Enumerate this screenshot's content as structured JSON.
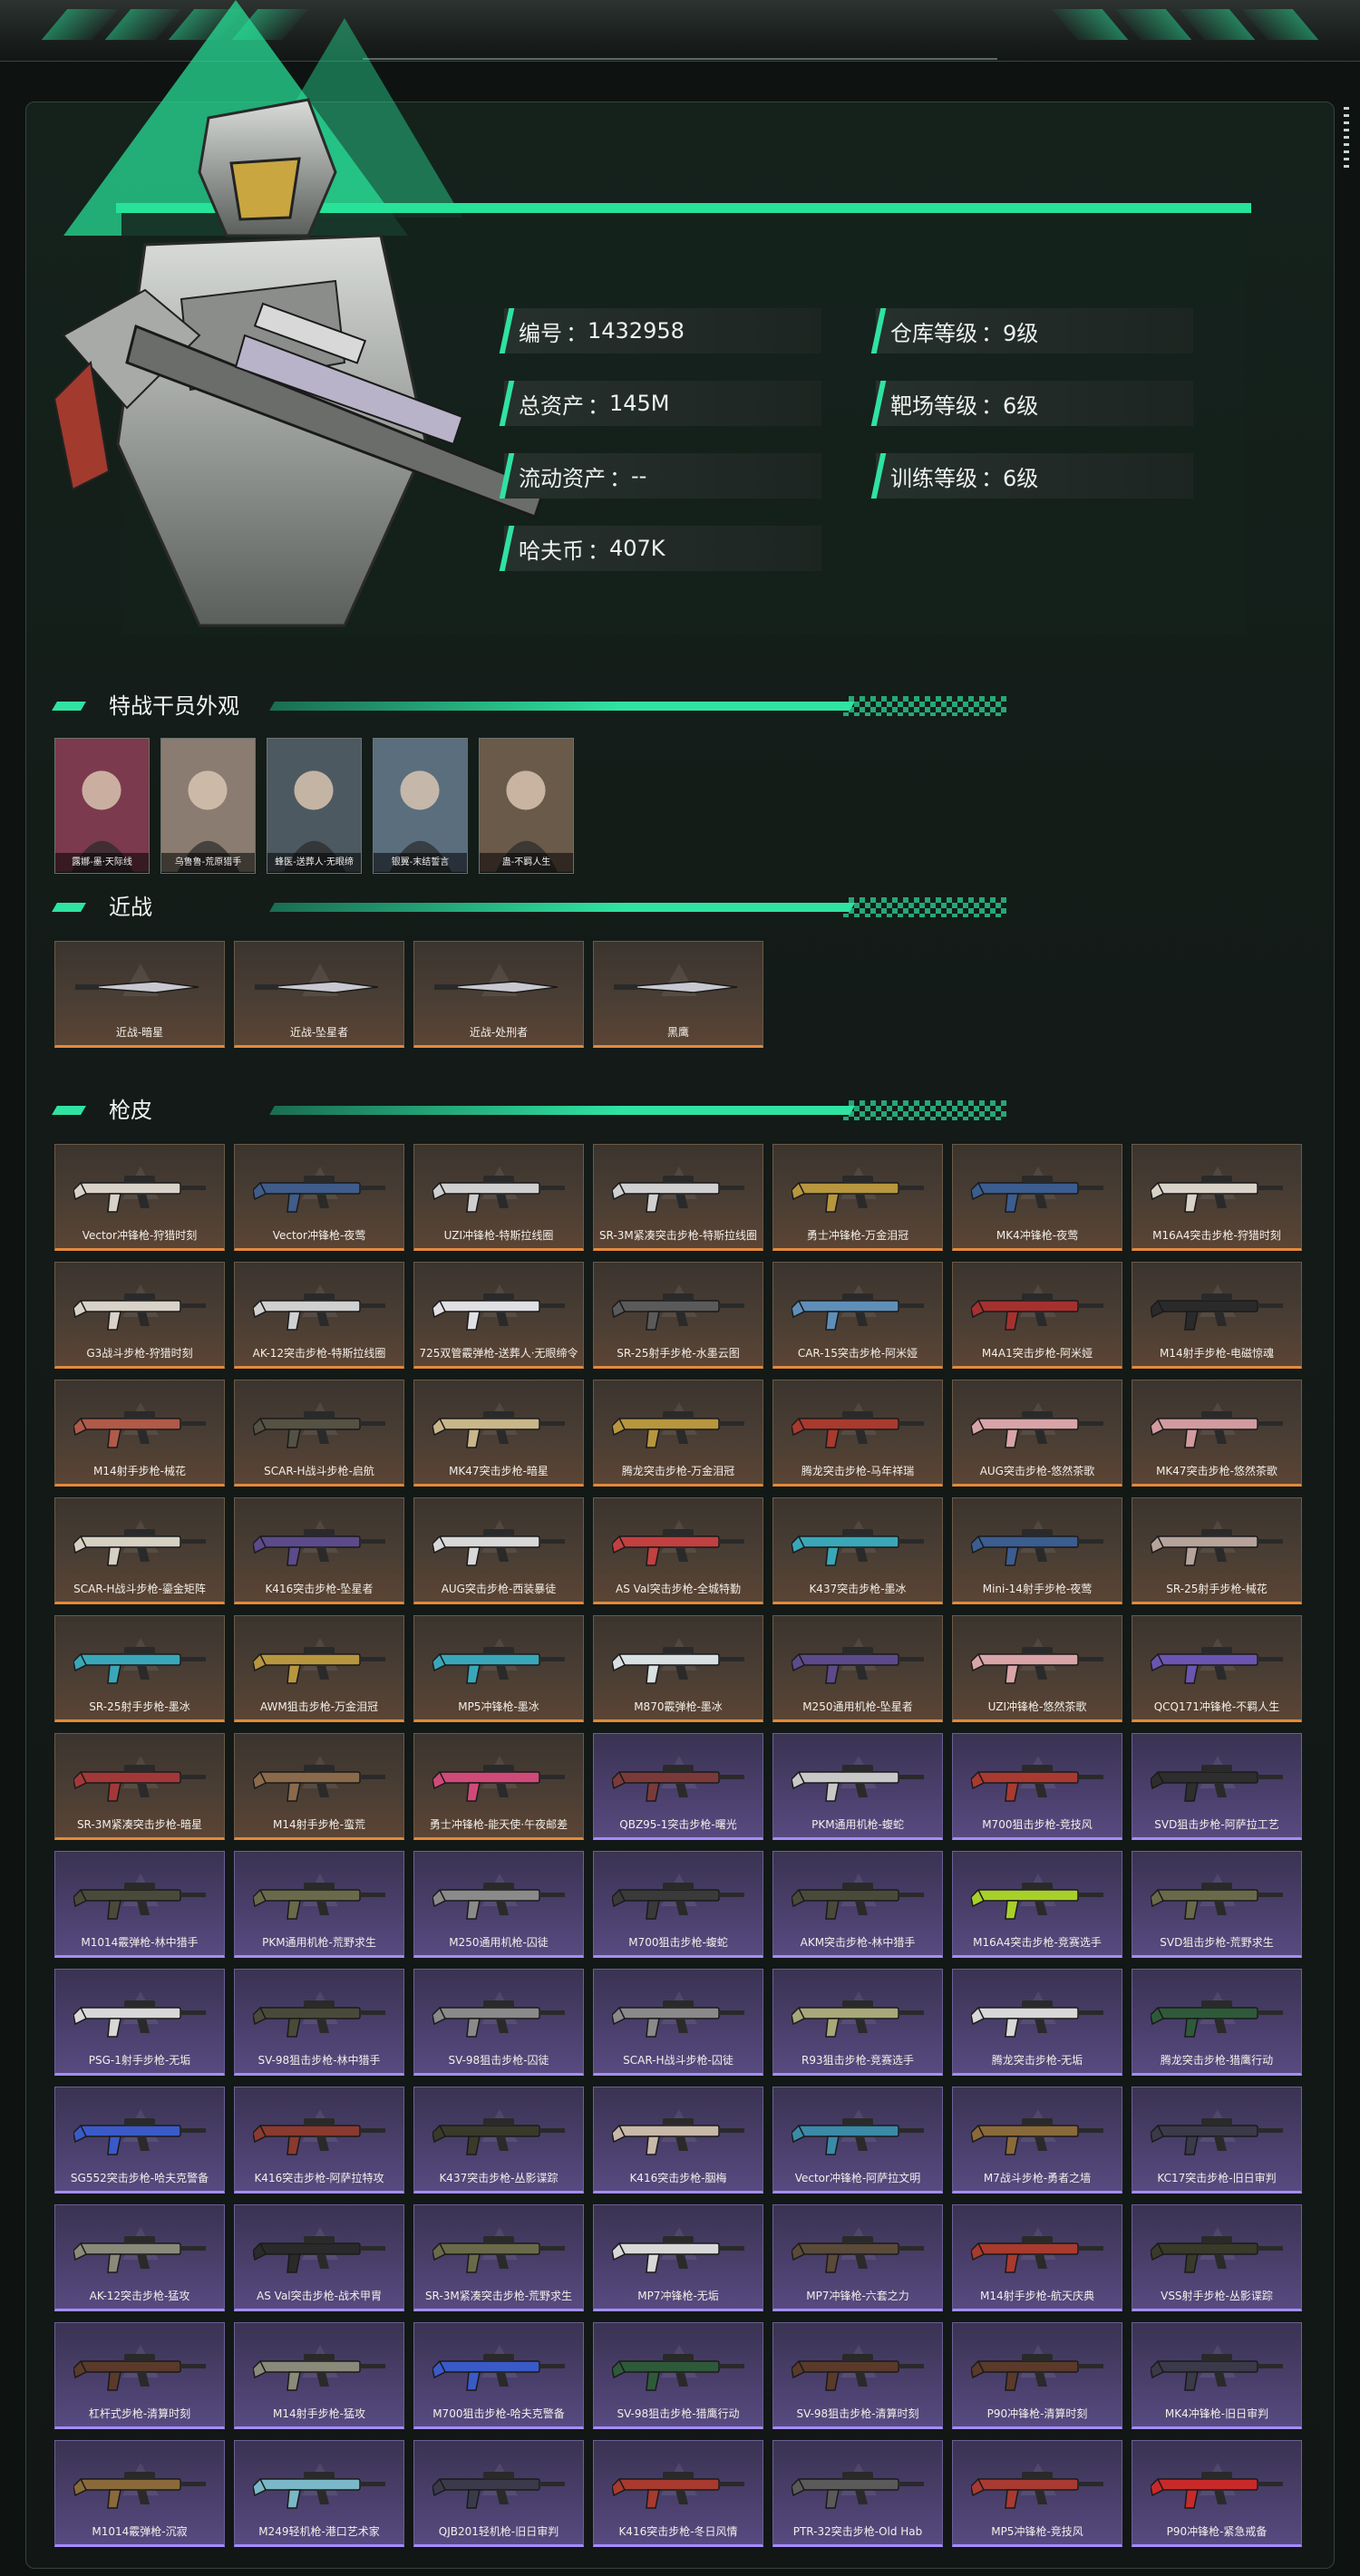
{
  "profile": {
    "stats": [
      {
        "key": "编号",
        "value": "1432958"
      },
      {
        "key": "仓库等级",
        "value": "9级"
      },
      {
        "key": "总资产",
        "value": "145M"
      },
      {
        "key": "靶场等级",
        "value": "6级"
      },
      {
        "key": "流动资产",
        "value": "--"
      },
      {
        "key": "训练等级",
        "value": "6级"
      },
      {
        "key": "哈夫币",
        "value": "407K"
      }
    ]
  },
  "sections": {
    "operators": "特战干员外观",
    "melee": "近战",
    "guns": "枪皮"
  },
  "operators": [
    {
      "name": "露娜-墨·天际线",
      "color": "#7b3a4d"
    },
    {
      "name": "乌鲁鲁-荒原猎手",
      "color": "#8a7c70"
    },
    {
      "name": "蜂医-送葬人·无眼缔",
      "color": "#4c5961"
    },
    {
      "name": "银翼-末结誓言",
      "color": "#5a6e7e"
    },
    {
      "name": "蛊-不羁人生",
      "color": "#6a5a4a"
    }
  ],
  "melee": [
    {
      "name": "近战-暗星"
    },
    {
      "name": "近战-坠星者"
    },
    {
      "name": "近战-处刑者"
    },
    {
      "name": "黑鹰"
    }
  ],
  "guns": [
    {
      "name": "Vector冲锋枪-狩猎时刻",
      "rarity": "orange",
      "color": "#d8d2c8"
    },
    {
      "name": "Vector冲锋枪-夜莺",
      "rarity": "orange",
      "color": "#3f5c8a"
    },
    {
      "name": "UZI冲锋枪-特斯拉线圈",
      "rarity": "orange",
      "color": "#cfcfcf"
    },
    {
      "name": "SR-3M紧凑突击步枪-特斯拉线圈",
      "rarity": "orange",
      "color": "#d0d0d0"
    },
    {
      "name": "勇士冲锋枪-万金泪冠",
      "rarity": "orange",
      "color": "#b7963e"
    },
    {
      "name": "MK4冲锋枪-夜莺",
      "rarity": "orange",
      "color": "#3b5d8f"
    },
    {
      "name": "M16A4突击步枪-狩猎时刻",
      "rarity": "orange",
      "color": "#d8d2c8"
    },
    {
      "name": "G3战斗步枪-狩猎时刻",
      "rarity": "orange",
      "color": "#d8d2c8"
    },
    {
      "name": "AK-12突击步枪-特斯拉线圈",
      "rarity": "orange",
      "color": "#d0d0d0"
    },
    {
      "name": "725双管霰弹枪-送葬人·无眼缔令",
      "rarity": "orange",
      "color": "#e0e0e4"
    },
    {
      "name": "SR-25射手步枪-水墨云图",
      "rarity": "orange",
      "color": "#5a5a5a"
    },
    {
      "name": "CAR-15突击步枪-阿米娅",
      "rarity": "orange",
      "color": "#5f8fb8"
    },
    {
      "name": "M4A1突击步枪-阿米娅",
      "rarity": "orange",
      "color": "#a5312f"
    },
    {
      "name": "M14射手步枪-电磁惊魂",
      "rarity": "orange",
      "color": "#2a2a2a"
    },
    {
      "name": "M14射手步枪-械花",
      "rarity": "orange",
      "color": "#b05a48"
    },
    {
      "name": "SCAR-H战斗步枪-启航",
      "rarity": "orange",
      "color": "#555244"
    },
    {
      "name": "MK47突击步枪-暗星",
      "rarity": "orange",
      "color": "#c9b78a"
    },
    {
      "name": "腾龙突击步枪-万金泪冠",
      "rarity": "orange",
      "color": "#b7963e"
    },
    {
      "name": "腾龙突击步枪-马年祥瑞",
      "rarity": "orange",
      "color": "#a83a2e"
    },
    {
      "name": "AUG突击步枪-悠然茶歌",
      "rarity": "orange",
      "color": "#d9a4a8"
    },
    {
      "name": "MK47突击步枪-悠然茶歌",
      "rarity": "orange",
      "color": "#d29ba0"
    },
    {
      "name": "SCAR-H战斗步枪-鎏金矩阵",
      "rarity": "orange",
      "color": "#d6d0c2"
    },
    {
      "name": "K416突击步枪-坠星者",
      "rarity": "orange",
      "color": "#5c4a8a"
    },
    {
      "name": "AUG突击步枪-西装暴徒",
      "rarity": "orange",
      "color": "#d8d8d8"
    },
    {
      "name": "AS Val突击步枪-全城特勤",
      "rarity": "orange",
      "color": "#c24040"
    },
    {
      "name": "K437突击步枪-墨冰",
      "rarity": "orange",
      "color": "#3aa7b8"
    },
    {
      "name": "Mini-14射手步枪-夜莺",
      "rarity": "orange",
      "color": "#3b5d8f"
    },
    {
      "name": "SR-25射手步枪-械花",
      "rarity": "orange",
      "color": "#b6a39a"
    },
    {
      "name": "SR-25射手步枪-墨冰",
      "rarity": "orange",
      "color": "#3aa7b8"
    },
    {
      "name": "AWM狙击步枪-万金泪冠",
      "rarity": "orange",
      "color": "#b7963e"
    },
    {
      "name": "MP5冲锋枪-墨冰",
      "rarity": "orange",
      "color": "#3aa7b8"
    },
    {
      "name": "M870霰弹枪-墨冰",
      "rarity": "orange",
      "color": "#d8e0e2"
    },
    {
      "name": "M250通用机枪-坠星者",
      "rarity": "orange",
      "color": "#5c4a8a"
    },
    {
      "name": "UZI冲锋枪-悠然茶歌",
      "rarity": "orange",
      "color": "#d9a4a8"
    },
    {
      "name": "QCQ171冲锋枪-不羁人生",
      "rarity": "orange",
      "color": "#6a55b0"
    },
    {
      "name": "SR-3M紧凑突击步枪-暗星",
      "rarity": "orange",
      "color": "#a33838"
    },
    {
      "name": "M14射手步枪-蛮荒",
      "rarity": "orange",
      "color": "#8a6a4a"
    },
    {
      "name": "勇士冲锋枪-能天使·午夜邮差",
      "rarity": "orange",
      "color": "#d04a78"
    },
    {
      "name": "QBZ95-1突击步枪-曙光",
      "rarity": "purple",
      "color": "#7a3a3a"
    },
    {
      "name": "PKM通用机枪-蝮蛇",
      "rarity": "purple",
      "color": "#c8c8c8"
    },
    {
      "name": "M700狙击步枪-竞技风",
      "rarity": "purple",
      "color": "#a83a32"
    },
    {
      "name": "SVD狙击步枪-阿萨拉工艺",
      "rarity": "purple",
      "color": "#2e2e2e"
    },
    {
      "name": "M1014霰弹枪-林中猎手",
      "rarity": "purple",
      "color": "#4a4a3a"
    },
    {
      "name": "PKM通用机枪-荒野求生",
      "rarity": "purple",
      "color": "#6a6a4a"
    },
    {
      "name": "M250通用机枪-囚徒",
      "rarity": "purple",
      "color": "#8a8a8a"
    },
    {
      "name": "M700狙击步枪-蝮蛇",
      "rarity": "purple",
      "color": "#3a3a3a"
    },
    {
      "name": "AKM突击步枪-林中猎手",
      "rarity": "purple",
      "color": "#4a4a3a"
    },
    {
      "name": "M16A4突击步枪-竞赛选手",
      "rarity": "purple",
      "color": "#a8d02a"
    },
    {
      "name": "SVD狙击步枪-荒野求生",
      "rarity": "purple",
      "color": "#6a6a4a"
    },
    {
      "name": "PSG-1射手步枪-无垢",
      "rarity": "purple",
      "color": "#d8d8d8"
    },
    {
      "name": "SV-98狙击步枪-林中猎手",
      "rarity": "purple",
      "color": "#4a4a3a"
    },
    {
      "name": "SV-98狙击步枪-囚徒",
      "rarity": "purple",
      "color": "#8a8a8a"
    },
    {
      "name": "SCAR-H战斗步枪-囚徒",
      "rarity": "purple",
      "color": "#8a8a8a"
    },
    {
      "name": "R93狙击步枪-竞赛选手",
      "rarity": "purple",
      "color": "#a8a87a"
    },
    {
      "name": "腾龙突击步枪-无垢",
      "rarity": "purple",
      "color": "#d8d8d8"
    },
    {
      "name": "腾龙突击步枪-猎鹰行动",
      "rarity": "purple",
      "color": "#2e5a3a"
    },
    {
      "name": "SG552突击步枪-哈夫克警备",
      "rarity": "purple",
      "color": "#3a5ac8"
    },
    {
      "name": "K416突击步枪-阿萨拉特攻",
      "rarity": "purple",
      "color": "#8a3a2e"
    },
    {
      "name": "K437突击步枪-丛影谍踪",
      "rarity": "purple",
      "color": "#3a3a2a"
    },
    {
      "name": "K416突击步枪-胭梅",
      "rarity": "purple",
      "color": "#c8b8a8"
    },
    {
      "name": "Vector冲锋枪-阿萨拉文明",
      "rarity": "purple",
      "color": "#3a8aa8"
    },
    {
      "name": "M7战斗步枪-勇者之墙",
      "rarity": "purple",
      "color": "#8a6a3a"
    },
    {
      "name": "KC17突击步枪-旧日审判",
      "rarity": "purple",
      "color": "#3a3a4a"
    },
    {
      "name": "AK-12突击步枪-猛攻",
      "rarity": "purple",
      "color": "#8a8a7a"
    },
    {
      "name": "AS Val突击步枪-战术甲胄",
      "rarity": "purple",
      "color": "#2a2a2a"
    },
    {
      "name": "SR-3M紧凑突击步枪-荒野求生",
      "rarity": "purple",
      "color": "#6a6a4a"
    },
    {
      "name": "MP7冲锋枪-无垢",
      "rarity": "purple",
      "color": "#d8d8d8"
    },
    {
      "name": "MP7冲锋枪-六套之力",
      "rarity": "purple",
      "color": "#5a4a3a"
    },
    {
      "name": "M14射手步枪-航天庆典",
      "rarity": "purple",
      "color": "#a83a2e"
    },
    {
      "name": "VSS射手步枪-丛影谍踪",
      "rarity": "purple",
      "color": "#3a3a2a"
    },
    {
      "name": "杠杆式步枪-清算时刻",
      "rarity": "purple",
      "color": "#5a3a2a"
    },
    {
      "name": "M14射手步枪-猛攻",
      "rarity": "purple",
      "color": "#8a8a7a"
    },
    {
      "name": "M700狙击步枪-哈夫克警备",
      "rarity": "purple",
      "color": "#3a5ac8"
    },
    {
      "name": "SV-98狙击步枪-猎鹰行动",
      "rarity": "purple",
      "color": "#2e5a3a"
    },
    {
      "name": "SV-98狙击步枪-清算时刻",
      "rarity": "purple",
      "color": "#5a3a2a"
    },
    {
      "name": "P90冲锋枪-清算时刻",
      "rarity": "purple",
      "color": "#5a3a2a"
    },
    {
      "name": "MK4冲锋枪-旧日审判",
      "rarity": "purple",
      "color": "#3a3a4a"
    },
    {
      "name": "M1014霰弹枪-沉寂",
      "rarity": "purple",
      "color": "#8a6a3a"
    },
    {
      "name": "M249轻机枪-港口艺术家",
      "rarity": "purple",
      "color": "#7ab8c8"
    },
    {
      "name": "QJB201轻机枪-旧日审判",
      "rarity": "purple",
      "color": "#3a3a4a"
    },
    {
      "name": "K416突击步枪-冬日风情",
      "rarity": "purple",
      "color": "#a83a2e"
    },
    {
      "name": "PTR-32突击步枪-Old Hab",
      "rarity": "purple",
      "color": "#5a5a5a"
    },
    {
      "name": "MP5冲锋枪-竞技风",
      "rarity": "purple",
      "color": "#a83a32"
    },
    {
      "name": "P90冲锋枪-紧急戒备",
      "rarity": "purple",
      "color": "#c82a2a"
    }
  ],
  "colors": {
    "accent": "#2fe3a2",
    "orange_rarity": "#e38a3b",
    "purple_rarity": "#a58cff"
  }
}
